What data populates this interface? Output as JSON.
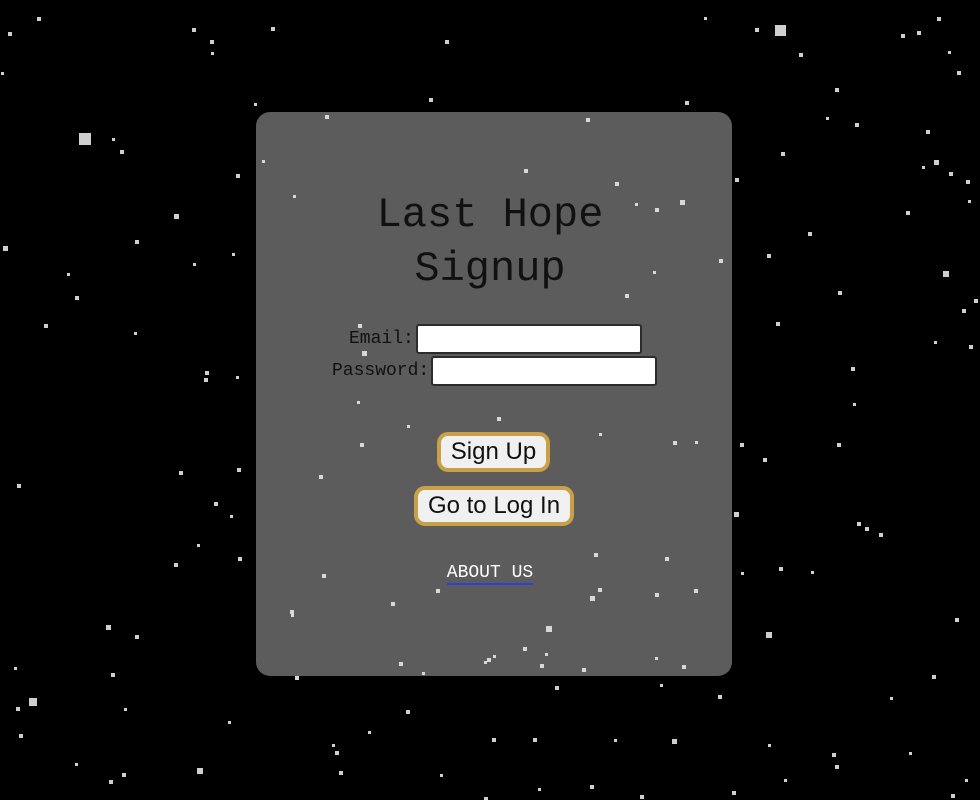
{
  "page": {
    "background_color": "#000000",
    "panel_color": "#5c5c5c",
    "button_border_color": "#c8a048",
    "link_underline_color": "#2c3fd8"
  },
  "signup": {
    "title_line1": "Last Hope",
    "title_line2": "Signup",
    "email_label": "Email:",
    "password_label": "Password:",
    "email_value": "",
    "password_value": "",
    "signup_button": "Sign Up",
    "login_button": "Go to Log In",
    "about_link": "ABOUT US"
  }
}
